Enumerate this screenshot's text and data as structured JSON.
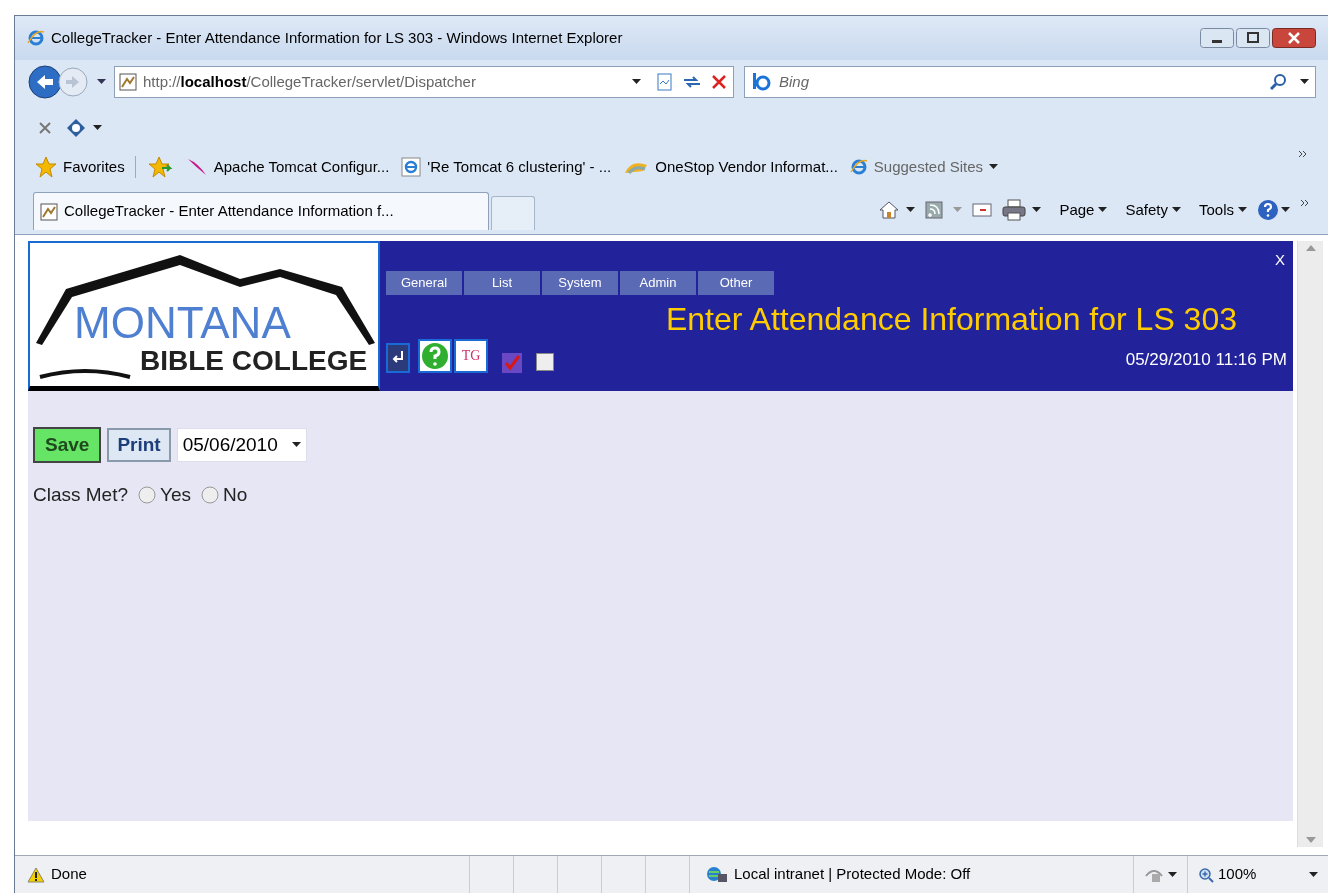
{
  "window": {
    "title": "CollegeTracker - Enter Attendance Information for LS 303 - Windows Internet Explorer"
  },
  "address_bar": {
    "url_prefix": "http://",
    "url_host": "localhost",
    "url_path": "/CollegeTracker/servlet/Dispatcher"
  },
  "search": {
    "placeholder": "Bing"
  },
  "favorites": {
    "label": "Favorites",
    "items": [
      {
        "label": "Apache Tomcat Configur..."
      },
      {
        "label": "'Re Tomcat 6 clustering' - ..."
      },
      {
        "label": "OneStop Vendor Informat..."
      },
      {
        "label": "Suggested Sites"
      }
    ]
  },
  "tabs": [
    {
      "label": "CollegeTracker - Enter Attendance Information f...",
      "selected": true
    }
  ],
  "command_menus": [
    {
      "label": "Page"
    },
    {
      "label": "Safety"
    },
    {
      "label": "Tools"
    }
  ],
  "page": {
    "logo": {
      "line1": "MONTANA",
      "line2": "BIBLE COLLEGE"
    },
    "menu": [
      {
        "label": "General"
      },
      {
        "label": "List"
      },
      {
        "label": "System"
      },
      {
        "label": "Admin"
      },
      {
        "label": "Other"
      }
    ],
    "close": "X",
    "title": "Enter Attendance Information for LS 303",
    "tg_label": "TG",
    "toggles": [
      {
        "checked": true
      },
      {
        "checked": false
      }
    ],
    "datetime": "05/29/2010 11:16 PM",
    "buttons": [
      {
        "label": "Save",
        "kind": "primary"
      },
      {
        "label": "Print",
        "kind": "secondary"
      }
    ],
    "date_select": {
      "value": "05/06/2010"
    },
    "class_met": {
      "label": "Class Met?",
      "options": [
        {
          "label": "Yes",
          "selected": false
        },
        {
          "label": "No",
          "selected": false
        }
      ]
    }
  },
  "status_bar": {
    "text": "Done",
    "zone": "Local intranet | Protected Mode: Off",
    "zoom": "100%"
  }
}
